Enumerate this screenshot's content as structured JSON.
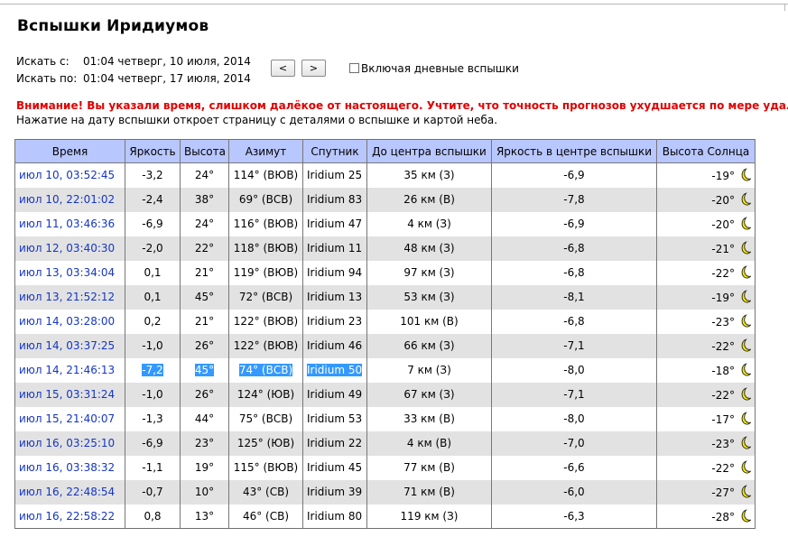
{
  "page": {
    "title": "Вспышки Иридиумов",
    "range": {
      "from_label": "Искать с:",
      "from_value": "01:04 четверг, 10 июля, 2014",
      "to_label": "Искать по:",
      "to_value": "01:04 четверг, 17 июля, 2014"
    },
    "nav": {
      "prev_label": "<",
      "next_label": ">"
    },
    "daytime_checkbox": {
      "label": "Включая дневные вспышки",
      "checked": false
    },
    "warning": "Внимание! Вы указали время, слишком далёкое от настоящего. Учтите, что точность прогнозов ухудшается по мере удалени",
    "hint": "Нажатие на дату вспышки откроет страницу с деталями о вспышке и картой неба."
  },
  "table": {
    "headers": [
      "Время",
      "Яркость",
      "Высота",
      "Азимут",
      "Спутник",
      "До центра вспышки",
      "Яркость в центре вспышки",
      "Высота Солнца"
    ],
    "sun_icon": "crescent-moon-icon",
    "colors": {
      "header_bg": "#b9c7ff",
      "stripe": "#e2e2e2",
      "link": "#1536c4",
      "warning": "#e00000",
      "selection": "#3399ff"
    },
    "selected_row": 8,
    "rows": [
      {
        "time": "июл 10, 03:52:45",
        "mag": "-3,2",
        "alt": "24°",
        "az": "114° (ВЮВ)",
        "sat": "Iridium 25",
        "dist": "35 км (З)",
        "center_mag": "-6,9",
        "sun": "-19°"
      },
      {
        "time": "июл 10, 22:01:02",
        "mag": "-2,4",
        "alt": "38°",
        "az": "69° (ВСВ)",
        "sat": "Iridium 83",
        "dist": "26 км (В)",
        "center_mag": "-7,8",
        "sun": "-20°"
      },
      {
        "time": "июл 11, 03:46:36",
        "mag": "-6,9",
        "alt": "24°",
        "az": "116° (ВЮВ)",
        "sat": "Iridium 47",
        "dist": "4 км (З)",
        "center_mag": "-6,9",
        "sun": "-20°"
      },
      {
        "time": "июл 12, 03:40:30",
        "mag": "-2,0",
        "alt": "22°",
        "az": "118° (ВЮВ)",
        "sat": "Iridium 11",
        "dist": "48 км (З)",
        "center_mag": "-6,8",
        "sun": "-21°"
      },
      {
        "time": "июл 13, 03:34:04",
        "mag": "0,1",
        "alt": "21°",
        "az": "119° (ВЮВ)",
        "sat": "Iridium 94",
        "dist": "97 км (З)",
        "center_mag": "-6,8",
        "sun": "-22°"
      },
      {
        "time": "июл 13, 21:52:12",
        "mag": "0,1",
        "alt": "45°",
        "az": "72° (ВСВ)",
        "sat": "Iridium 13",
        "dist": "53 км (З)",
        "center_mag": "-8,1",
        "sun": "-19°"
      },
      {
        "time": "июл 14, 03:28:00",
        "mag": "0,2",
        "alt": "21°",
        "az": "122° (ВЮВ)",
        "sat": "Iridium 23",
        "dist": "101 км (В)",
        "center_mag": "-6,8",
        "sun": "-23°"
      },
      {
        "time": "июл 14, 03:37:25",
        "mag": "-1,0",
        "alt": "26°",
        "az": "122° (ВЮВ)",
        "sat": "Iridium 46",
        "dist": "66 км (З)",
        "center_mag": "-7,1",
        "sun": "-22°"
      },
      {
        "time": "июл 14, 21:46:13",
        "mag": "-7,2",
        "alt": "45°",
        "az": "74° (ВСВ)",
        "sat": "Iridium 50",
        "dist": "7 км (З)",
        "center_mag": "-8,0",
        "sun": "-18°"
      },
      {
        "time": "июл 15, 03:31:24",
        "mag": "-1,0",
        "alt": "26°",
        "az": "124° (ЮВ)",
        "sat": "Iridium 49",
        "dist": "67 км (З)",
        "center_mag": "-7,1",
        "sun": "-22°"
      },
      {
        "time": "июл 15, 21:40:07",
        "mag": "-1,3",
        "alt": "44°",
        "az": "75° (ВСВ)",
        "sat": "Iridium 53",
        "dist": "33 км (В)",
        "center_mag": "-8,0",
        "sun": "-17°"
      },
      {
        "time": "июл 16, 03:25:10",
        "mag": "-6,9",
        "alt": "23°",
        "az": "125° (ЮВ)",
        "sat": "Iridium 22",
        "dist": "4 км (В)",
        "center_mag": "-7,0",
        "sun": "-23°"
      },
      {
        "time": "июл 16, 03:38:32",
        "mag": "-1,1",
        "alt": "19°",
        "az": "115° (ВЮВ)",
        "sat": "Iridium 45",
        "dist": "77 км (В)",
        "center_mag": "-6,6",
        "sun": "-22°"
      },
      {
        "time": "июл 16, 22:48:54",
        "mag": "-0,7",
        "alt": "10°",
        "az": "43° (СВ)",
        "sat": "Iridium 39",
        "dist": "71 км (В)",
        "center_mag": "-6,0",
        "sun": "-27°"
      },
      {
        "time": "июл 16, 22:58:22",
        "mag": "0,8",
        "alt": "13°",
        "az": "46° (СВ)",
        "sat": "Iridium 80",
        "dist": "119 км (З)",
        "center_mag": "-6,3",
        "sun": "-28°"
      }
    ]
  }
}
